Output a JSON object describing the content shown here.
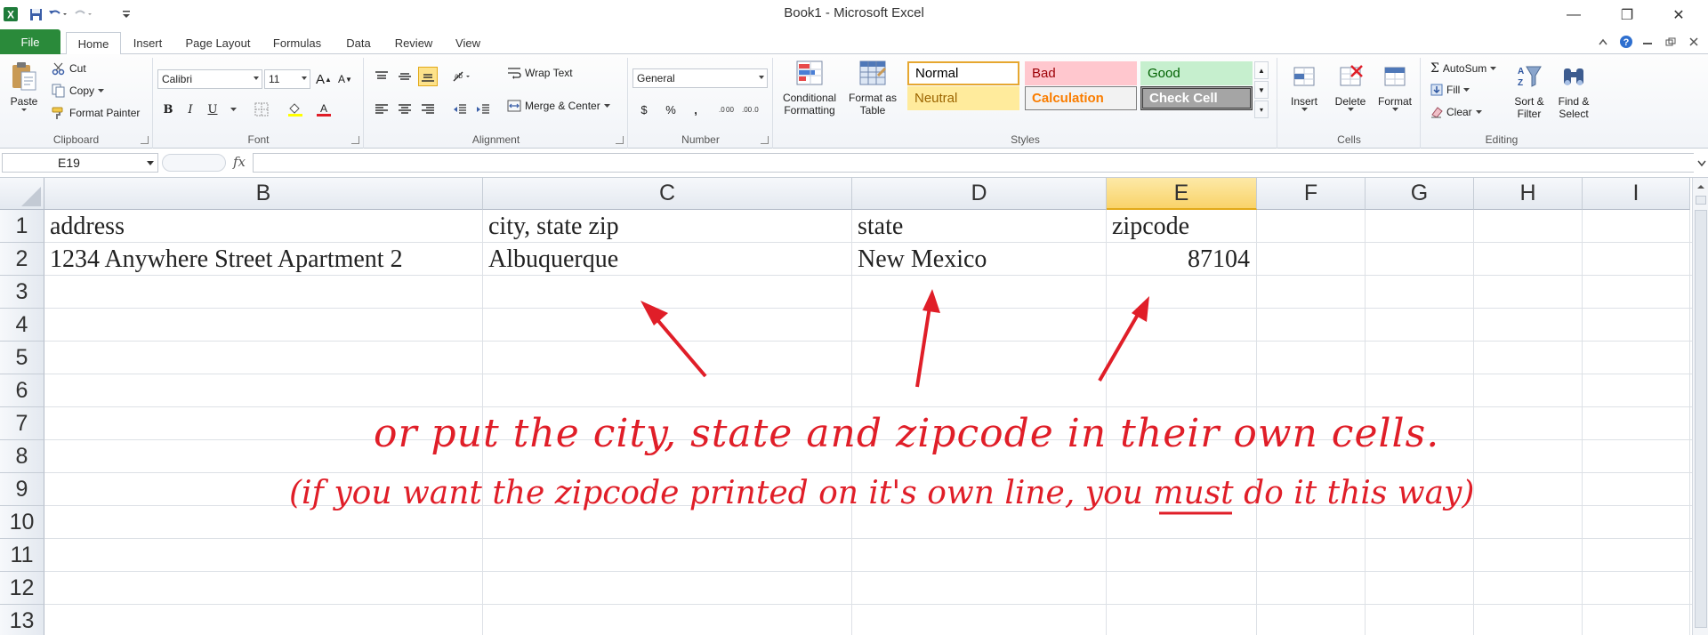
{
  "window": {
    "title": "Book1 - Microsoft Excel",
    "minimize": "—",
    "restore": "❐",
    "close": "✕"
  },
  "tabs": {
    "file": "File",
    "items": [
      "Home",
      "Insert",
      "Page Layout",
      "Formulas",
      "Data",
      "Review",
      "View"
    ],
    "active": "Home"
  },
  "ribbon": {
    "clipboard": {
      "label": "Clipboard",
      "paste": "Paste",
      "cut": "Cut",
      "copy": "Copy",
      "format_painter": "Format Painter"
    },
    "font": {
      "label": "Font",
      "font_name": "Calibri",
      "font_size": "11",
      "bold": "B",
      "italic": "I",
      "underline": "U",
      "grow": "A",
      "shrink": "A"
    },
    "alignment": {
      "label": "Alignment",
      "wrap_text": "Wrap Text",
      "merge_center": "Merge & Center"
    },
    "number": {
      "label": "Number",
      "format": "General",
      "currency": "$",
      "percent": "%",
      "comma": ","
    },
    "styles": {
      "label": "Styles",
      "conditional_formatting": [
        "Conditional",
        "Formatting"
      ],
      "format_as_table": [
        "Format as",
        "Table"
      ],
      "cells": [
        {
          "name": "Normal",
          "bg": "#ffffff",
          "fg": "#000000",
          "border": "#e6a730"
        },
        {
          "name": "Bad",
          "bg": "#ffc7ce",
          "fg": "#9c0006",
          "border": "#ffc7ce"
        },
        {
          "name": "Good",
          "bg": "#c6efce",
          "fg": "#006100",
          "border": "#c6efce"
        },
        {
          "name": "Neutral",
          "bg": "#ffeb9c",
          "fg": "#9c6500",
          "border": "#ffeb9c"
        },
        {
          "name": "Calculation",
          "bg": "#f2f2f2",
          "fg": "#fa7d00",
          "border": "#7f7f7f"
        },
        {
          "name": "Check Cell",
          "bg": "#a5a5a5",
          "fg": "#ffffff",
          "border": "#3f3f3f"
        }
      ]
    },
    "cells": {
      "label": "Cells",
      "insert": "Insert",
      "delete": "Delete",
      "format": "Format"
    },
    "editing": {
      "label": "Editing",
      "autosum": "AutoSum",
      "fill": "Fill",
      "clear": "Clear",
      "sort_filter": [
        "Sort &",
        "Filter"
      ],
      "find_select": [
        "Find &",
        "Select"
      ]
    }
  },
  "formula_bar": {
    "name_box": "E19",
    "fx": "fx",
    "value": ""
  },
  "grid": {
    "columns": [
      "B",
      "C",
      "D",
      "E",
      "F",
      "G",
      "H",
      "I"
    ],
    "selected_column": "E",
    "rows": [
      "1",
      "2",
      "3",
      "4",
      "5",
      "6",
      "7",
      "8",
      "9",
      "10",
      "11",
      "12",
      "13"
    ],
    "cells": {
      "B1": "address",
      "C1": "city, state zip",
      "D1": "state",
      "E1": "zipcode",
      "B2": "1234 Anywhere Street Apartment 2",
      "C2": "Albuquerque",
      "D2": "New Mexico",
      "E2": "87104"
    }
  },
  "annotation": {
    "line1": "or put the city, state and zipcode in their own cells.",
    "line2_pre": "(if you want the zipcode printed on it's own line, you ",
    "line2_em": "must",
    "line2_post": " do it this way)",
    "color": "#e01e28"
  }
}
